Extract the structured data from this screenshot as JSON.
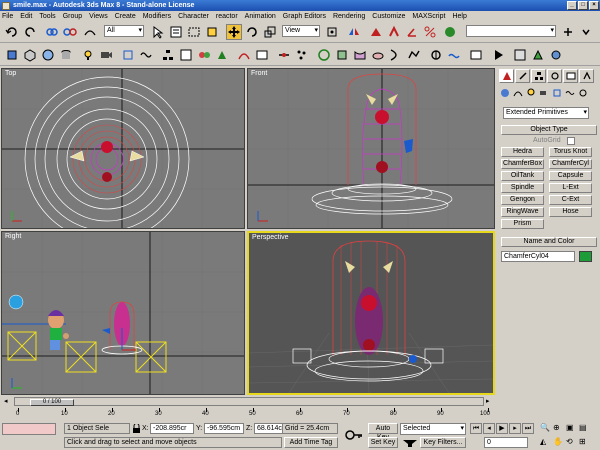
{
  "window": {
    "title": "smile.max - Autodesk 3ds Max 8 - Stand-alone License",
    "controls": [
      "_",
      "□",
      "×"
    ]
  },
  "menu": [
    "File",
    "Edit",
    "Tools",
    "Group",
    "Views",
    "Create",
    "Modifiers",
    "Character",
    "reactor",
    "Animation",
    "Graph Editors",
    "Rendering",
    "Customize",
    "MAXScript",
    "Help"
  ],
  "toolbar": {
    "selection_filter": "All",
    "ref_coord": "View"
  },
  "viewports": {
    "top_label": "Top",
    "front_label": "Front",
    "right_label": "Right",
    "perspective_label": "Perspective"
  },
  "command_panel": {
    "category_dropdown": "Extended Primitives",
    "object_type_header": "Object Type",
    "autogrid_label": "AutoGrid",
    "buttons": [
      "Hedra",
      "Torus Knot",
      "ChamferBox",
      "ChamferCyl",
      "OilTank",
      "Capsule",
      "Spindle",
      "L-Ext",
      "Gengon",
      "C-Ext",
      "RingWave",
      "Hose",
      "Prism"
    ],
    "name_color_header": "Name and Color",
    "object_name": "ChamferCyl04",
    "object_color": "#1e9c3a"
  },
  "timeline": {
    "frame_display": "0 / 100",
    "ticks": [
      "0",
      "10",
      "20",
      "30",
      "40",
      "50",
      "60",
      "70",
      "80",
      "90",
      "100"
    ]
  },
  "status": {
    "selection": "1 Object Sele",
    "x_label": "X:",
    "x_value": "-208.895cr",
    "y_label": "Y:",
    "y_value": "-96.595cm",
    "z_label": "Z:",
    "z_value": "68.614cm",
    "grid": "Grid = 25.4cm",
    "prompt": "Click and drag to select and move objects",
    "add_time_tag": "Add Time Tag",
    "auto_key": "Auto Key",
    "key_mode": "Selected",
    "set_key": "Set Key",
    "key_filters": "Key Filters...",
    "current_frame": "0"
  }
}
